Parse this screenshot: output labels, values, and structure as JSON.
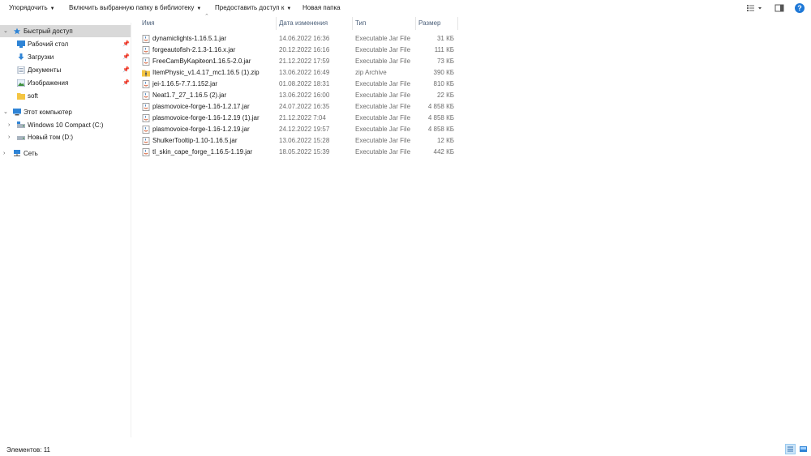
{
  "toolbar": {
    "organize_label": "Упорядочить",
    "include_library_label": "Включить выбранную папку в библиотеку",
    "share_label": "Предоставить доступ к",
    "new_folder_label": "Новая папка",
    "help_label": "?"
  },
  "columns": {
    "name": "Имя",
    "date": "Дата изменения",
    "type": "Тип",
    "size": "Размер"
  },
  "sidebar": {
    "quick_access": "Быстрый доступ",
    "quick_items": [
      "Рабочий стол",
      "Загрузки",
      "Документы",
      "Изображения",
      "soft"
    ],
    "this_pc": "Этот компьютер",
    "drives": [
      "Windows 10 Compact (C:)",
      "Новый том (D:)"
    ],
    "network": "Сеть"
  },
  "files": [
    {
      "name": "dynamiclights-1.16.5.1.jar",
      "date": "14.06.2022 16:36",
      "type": "Executable Jar File",
      "size": "31 КБ",
      "icon": "jar-icon"
    },
    {
      "name": "forgeautofish-2.1.3-1.16.x.jar",
      "date": "20.12.2022 16:16",
      "type": "Executable Jar File",
      "size": "111 КБ",
      "icon": "jar-icon"
    },
    {
      "name": "FreeCamByKapiteon1.16.5-2.0.jar",
      "date": "21.12.2022 17:59",
      "type": "Executable Jar File",
      "size": "73 КБ",
      "icon": "jar-icon"
    },
    {
      "name": "ItemPhysic_v1.4.17_mc1.16.5 (1).zip",
      "date": "13.06.2022 16:49",
      "type": "zip Archive",
      "size": "390 КБ",
      "icon": "zip-icon"
    },
    {
      "name": "jei-1.16.5-7.7.1.152.jar",
      "date": "01.08.2022 18:31",
      "type": "Executable Jar File",
      "size": "810 КБ",
      "icon": "jar-icon"
    },
    {
      "name": "Neat1.7_27_1.16.5 (2).jar",
      "date": "13.06.2022 16:00",
      "type": "Executable Jar File",
      "size": "22 КБ",
      "icon": "jar-icon"
    },
    {
      "name": "plasmovoice-forge-1.16-1.2.17.jar",
      "date": "24.07.2022 16:35",
      "type": "Executable Jar File",
      "size": "4 858 КБ",
      "icon": "jar-icon"
    },
    {
      "name": "plasmovoice-forge-1.16-1.2.19 (1).jar",
      "date": "21.12.2022 7:04",
      "type": "Executable Jar File",
      "size": "4 858 КБ",
      "icon": "jar-icon"
    },
    {
      "name": "plasmovoice-forge-1.16-1.2.19.jar",
      "date": "24.12.2022 19:57",
      "type": "Executable Jar File",
      "size": "4 858 КБ",
      "icon": "jar-icon"
    },
    {
      "name": "ShulkerTooltip-1.10-1.16.5.jar",
      "date": "13.06.2022 15:28",
      "type": "Executable Jar File",
      "size": "12 КБ",
      "icon": "jar-icon"
    },
    {
      "name": "tl_skin_cape_forge_1.16.5-1.19.jar",
      "date": "18.05.2022 15:39",
      "type": "Executable Jar File",
      "size": "442 КБ",
      "icon": "jar-icon"
    }
  ],
  "status": {
    "items_count": "Элементов: 11"
  },
  "colors": {
    "accent": "#1e78d7",
    "selected_bg": "#d9d9d9",
    "header_text": "#4c607a",
    "muted_text": "#6d6d6d"
  }
}
